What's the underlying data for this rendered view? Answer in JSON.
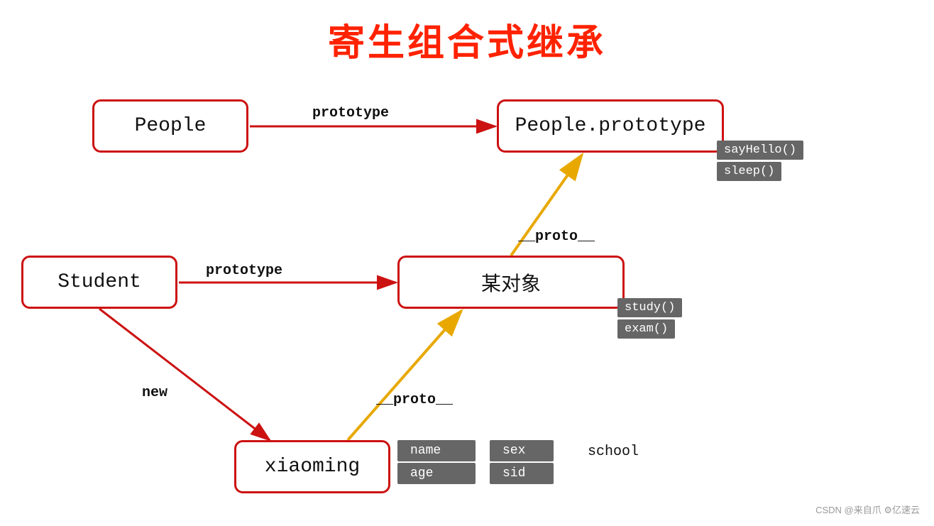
{
  "title": "寄生组合式继承",
  "boxes": {
    "people": "People",
    "people_prototype": "People.prototype",
    "student": "Student",
    "some_object": "某对象",
    "xiaoming": "xiaoming"
  },
  "tags": {
    "sayhello": "sayHello()",
    "sleep": "sleep()",
    "study": "study()",
    "exam": "exam()"
  },
  "props": {
    "name": "name",
    "age": "age",
    "sex": "sex",
    "sid": "sid",
    "school": "school"
  },
  "arrow_labels": {
    "prototype_top": "prototype",
    "proto_top": "__proto__",
    "prototype_mid": "prototype",
    "proto_mid": "__proto__",
    "new_label": "new"
  },
  "footer": "CSDN @来自爪  ⚙亿速云"
}
